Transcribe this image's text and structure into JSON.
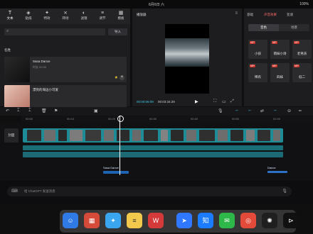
{
  "status": {
    "time": "6月6日 六",
    "right": "100%"
  },
  "toolbar": {
    "items": [
      {
        "label": "文本",
        "icon": "text-icon"
      },
      {
        "label": "贴纸",
        "icon": "sticker-icon"
      },
      {
        "label": "特效",
        "icon": "effects-icon"
      },
      {
        "label": "转场",
        "icon": "transition-icon"
      },
      {
        "label": "滤镜",
        "icon": "filter-icon"
      },
      {
        "label": "调节",
        "icon": "adjust-icon"
      },
      {
        "label": "模板",
        "icon": "template-icon"
      }
    ]
  },
  "search": {
    "placeholder": "",
    "import_label": "导入"
  },
  "library": {
    "section": "名胜",
    "items": [
      {
        "title": "Sasa Dance",
        "meta": "时长 00:30"
      },
      {
        "title": "漂亮的海边小可爱",
        "meta": ""
      }
    ]
  },
  "player": {
    "title": "播放器",
    "caption": "",
    "time_current": "00:00:06:09",
    "time_total": "00:03:34:29"
  },
  "right": {
    "tabs": [
      "基础",
      "声音效果",
      "变速"
    ],
    "subtabs": [
      "音色",
      "场景"
    ],
    "effects": [
      {
        "label": "小孩",
        "badge": "VIP"
      },
      {
        "label": "萌妹小诗",
        "badge": "VIP"
      },
      {
        "label": "老男孩",
        "badge": "VIP"
      },
      {
        "label": "稀有",
        "badge": "VIP"
      },
      {
        "label": "四妹",
        "badge": "VIP"
      },
      {
        "label": "低二",
        "badge": "VIP"
      }
    ]
  },
  "ruler": {
    "ticks": [
      "00:00",
      "00:10",
      "00:20",
      "00:30",
      "00:40",
      "00:50",
      "01:00"
    ]
  },
  "timeline": {
    "cover_label": "封面",
    "audio_label_1": "Sasa Dance",
    "audio_label_2": "Dance"
  },
  "chat": {
    "placeholder": "给 ChatGPT 发送消息"
  },
  "dock": {
    "apps": [
      {
        "name": "finder-icon",
        "color": "#2f7ae5"
      },
      {
        "name": "launchpad-icon",
        "color": "#d64a3a"
      },
      {
        "name": "safari-icon",
        "color": "#3aa6f0"
      },
      {
        "name": "notes-icon",
        "color": "#f2c94c"
      },
      {
        "name": "wps-icon",
        "color": "#d43a3a"
      },
      {
        "name": "feishu-icon",
        "color": "#3078ff"
      },
      {
        "name": "zhihu-icon",
        "color": "#1b7cff"
      },
      {
        "name": "wechat-icon",
        "color": "#2fb84a"
      },
      {
        "name": "chrome-icon",
        "color": "#e44a3a"
      },
      {
        "name": "chatgpt-icon",
        "color": "#1f1f1f"
      },
      {
        "name": "capcut-icon",
        "color": "#111111"
      }
    ]
  }
}
